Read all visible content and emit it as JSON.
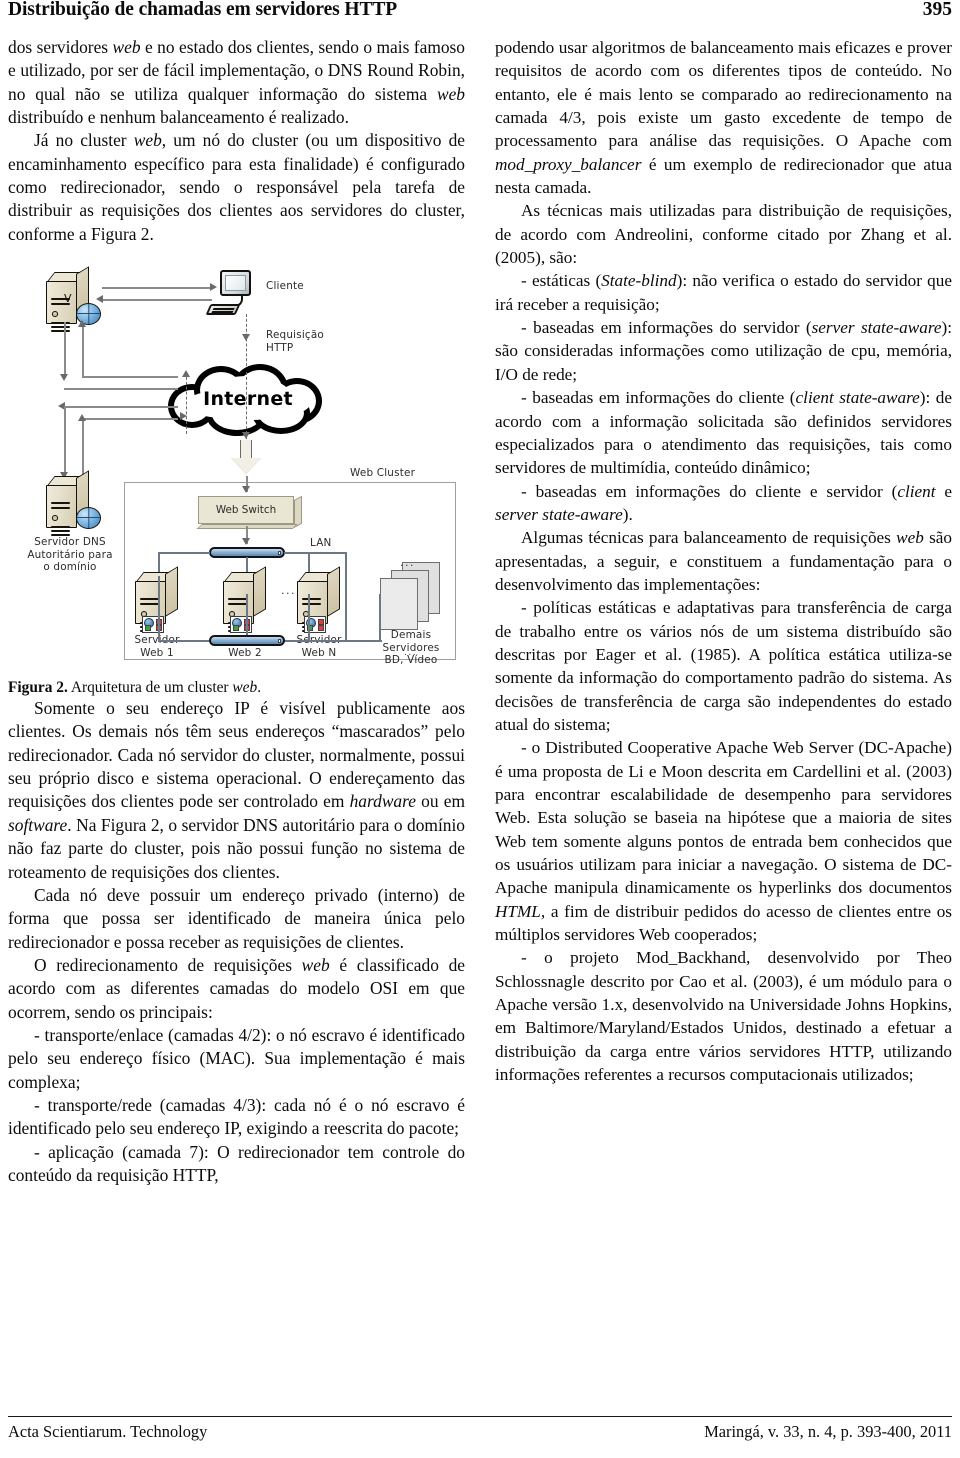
{
  "header": {
    "title": "Distribuição de chamadas em servidores HTTP",
    "folio": "395"
  },
  "left_column": {
    "paragraphs": [
      {
        "indent": false,
        "runs": [
          {
            "t": "dos servidores ",
            "i": false
          },
          {
            "t": "web",
            "i": true
          },
          {
            "t": " e no estado dos clientes, sendo o mais famoso e utilizado, por ser de fácil implementação, o DNS Round Robin, no qual não se utiliza qualquer informação do sistema ",
            "i": false
          },
          {
            "t": "web",
            "i": true
          },
          {
            "t": " distribuído e nenhum balanceamento é realizado.",
            "i": false
          }
        ]
      },
      {
        "indent": true,
        "runs": [
          {
            "t": "Já no cluster ",
            "i": false
          },
          {
            "t": "web",
            "i": true
          },
          {
            "t": ", um nó do cluster (ou um dispositivo de encaminhamento específico para esta finalidade) é configurado como redirecionador, sendo o responsável pela tarefa de distribuir as requisições dos clientes aos servidores do cluster, conforme a Figura 2.",
            "i": false
          }
        ]
      }
    ],
    "paragraphs_after_figure": [
      {
        "indent": true,
        "runs": [
          {
            "t": "Somente o seu endereço IP é visível publicamente aos clientes. Os demais nós têm seus endereços “mascarados” pelo redirecionador. Cada nó servidor do cluster, normalmente, possui seu próprio disco e sistema operacional. O endereçamento das requisições dos clientes pode ser controlado em ",
            "i": false
          },
          {
            "t": "hardware",
            "i": true
          },
          {
            "t": " ou em ",
            "i": false
          },
          {
            "t": "software",
            "i": true
          },
          {
            "t": ". Na Figura 2, o servidor DNS autoritário para o domínio não faz parte do cluster, pois não possui função no sistema de roteamento de requisições dos clientes.",
            "i": false
          }
        ]
      },
      {
        "indent": true,
        "runs": [
          {
            "t": "Cada nó deve possuir um endereço privado (interno) de forma que possa ser identificado de maneira única pelo redirecionador e possa receber as requisições de clientes.",
            "i": false
          }
        ]
      },
      {
        "indent": true,
        "runs": [
          {
            "t": "O redirecionamento de requisições ",
            "i": false
          },
          {
            "t": "web",
            "i": true
          },
          {
            "t": " é classificado de acordo com as diferentes camadas do modelo OSI em que ocorrem, sendo os principais:",
            "i": false
          }
        ]
      },
      {
        "indent": true,
        "runs": [
          {
            "t": "- transporte/enlace (camadas 4/2): o nó escravo é identificado pelo seu endereço físico (MAC). Sua implementação é mais complexa;",
            "i": false
          }
        ]
      },
      {
        "indent": true,
        "runs": [
          {
            "t": "- transporte/rede (camadas 4/3): cada nó é o nó escravo é identificado pelo seu endereço IP, exigindo a reescrita do pacote;",
            "i": false
          }
        ]
      },
      {
        "indent": true,
        "runs": [
          {
            "t": "- aplicação (camada 7): O redirecionador tem controle do conteúdo da requisição HTTP,",
            "i": false
          }
        ]
      }
    ],
    "figure": {
      "caption_label": "Figura 2.",
      "caption_text_before": " Arquitetura de um cluster ",
      "caption_italic": "web",
      "caption_text_after": ".",
      "labels": {
        "client": "Cliente",
        "request": "Requisição\nHTTP",
        "internet": "Internet",
        "dns_server": "Servidor DNS\nAutoritário para\no domínio",
        "web_cluster": "Web Cluster",
        "web_switch": "Web Switch",
        "lan": "LAN",
        "server_web_1": "Servidor\nWeb 1",
        "server_web_2": "Servidor\nWeb 2",
        "server_web_n": "Servidor\nWeb N",
        "other_servers": "Demais\nServidores\nBD, Vídeo",
        "ellipsis": "...",
        "dns_letter": "V"
      }
    }
  },
  "right_column": {
    "paragraphs": [
      {
        "indent": false,
        "runs": [
          {
            "t": "podendo usar algoritmos de balanceamento mais eficazes e prover requisitos de acordo com os diferentes tipos de conteúdo. No entanto, ele é mais lento se comparado ao redirecionamento na camada 4/3, pois existe um gasto excedente de tempo de processamento para análise das requisições. O Apache com ",
            "i": false
          },
          {
            "t": "mod_proxy_balancer",
            "i": true
          },
          {
            "t": " é um exemplo de redirecionador que atua nesta camada.",
            "i": false
          }
        ]
      },
      {
        "indent": true,
        "runs": [
          {
            "t": "As técnicas mais utilizadas para distribuição de requisições, de acordo com Andreolini, conforme citado por Zhang et al. (2005), são:",
            "i": false
          }
        ]
      },
      {
        "indent": true,
        "runs": [
          {
            "t": "- estáticas (",
            "i": false
          },
          {
            "t": "State-blind",
            "i": true
          },
          {
            "t": "): não verifica o estado do servidor que irá receber a requisição;",
            "i": false
          }
        ]
      },
      {
        "indent": true,
        "runs": [
          {
            "t": "- baseadas em informações do servidor (",
            "i": false
          },
          {
            "t": "server state-aware",
            "i": true
          },
          {
            "t": "): são consideradas informações como utilização de cpu, memória, I/O de rede;",
            "i": false
          }
        ]
      },
      {
        "indent": true,
        "runs": [
          {
            "t": "- baseadas em informações do cliente (",
            "i": false
          },
          {
            "t": "client state-aware",
            "i": true
          },
          {
            "t": "): de acordo com a informação solicitada são definidos servidores especializados para o atendimento das requisições, tais como servidores de multimídia, conteúdo dinâmico;",
            "i": false
          }
        ]
      },
      {
        "indent": true,
        "runs": [
          {
            "t": "- baseadas em informações do cliente e servidor (",
            "i": false
          },
          {
            "t": "client",
            "i": true
          },
          {
            "t": " e ",
            "i": false
          },
          {
            "t": "server state-aware",
            "i": true
          },
          {
            "t": ").",
            "i": false
          }
        ]
      },
      {
        "indent": true,
        "runs": [
          {
            "t": "Algumas técnicas para balanceamento de requisições ",
            "i": false
          },
          {
            "t": "web",
            "i": true
          },
          {
            "t": " são apresentadas, a seguir, e constituem a fundamentação para o desenvolvimento das implementações:",
            "i": false
          }
        ]
      },
      {
        "indent": true,
        "runs": [
          {
            "t": "- políticas estáticas e adaptativas para transferência de carga de trabalho entre os vários nós de um sistema distribuído são descritas por Eager et al. (1985). A política estática utiliza-se somente da informação do comportamento padrão do sistema. As decisões de transferência de carga são independentes do estado atual do sistema;",
            "i": false
          }
        ]
      },
      {
        "indent": true,
        "runs": [
          {
            "t": "- o Distributed Cooperative Apache Web Server (DC-Apache) é uma proposta de Li e Moon descrita em Cardellini et al. (2003) para encontrar escalabilidade de desempenho para servidores Web. Esta solução se baseia na hipótese que a maioria de sites Web tem somente alguns pontos de entrada bem conhecidos que os usuários utilizam para iniciar a navegação. O sistema de DC-Apache manipula dinamicamente os hyperlinks dos documentos ",
            "i": false
          },
          {
            "t": "HTML",
            "i": true
          },
          {
            "t": ", a fim de distribuir pedidos do acesso de clientes entre os múltiplos servidores Web cooperados;",
            "i": false
          }
        ]
      },
      {
        "indent": true,
        "runs": [
          {
            "t": "- o projeto Mod_Backhand, desenvolvido por Theo Schlossnagle descrito por Cao et al. (2003), é um módulo para o Apache versão 1.x, desenvolvido na Universidade Johns Hopkins, em Baltimore/Maryland/Estados Unidos, destinado a efetuar a distribuição da carga entre vários servidores HTTP, utilizando informações referentes a recursos computacionais utilizados;",
            "i": false
          }
        ]
      }
    ]
  },
  "footer": {
    "left": "Acta Scientiarum. Technology",
    "right": "Maringá, v. 33, n. 4, p. 393-400, 2011"
  },
  "colors": {
    "text": "#0b0b0b",
    "server_body": "#e3dcc6",
    "globe_blue": "#3a78b4",
    "lan_bar": "#8fb4d4",
    "switch_fill": "#eae6d4",
    "cluster_border": "#9aa0a8",
    "line_gray": "#8a8a8a"
  }
}
